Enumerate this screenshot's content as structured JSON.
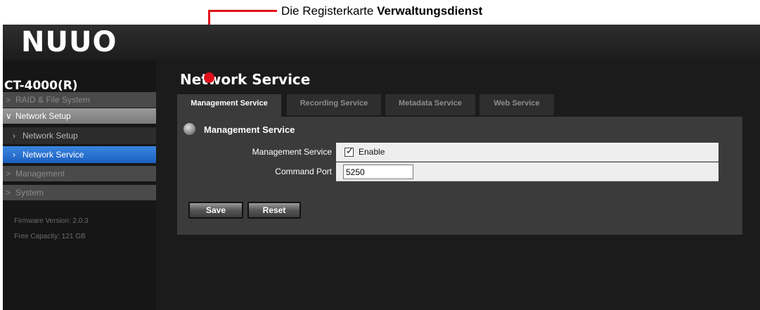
{
  "annotation": {
    "prefix": "Die Registerkarte ",
    "emphasis": "Verwaltungsdienst",
    "color": "#e0101a"
  },
  "header": {
    "logo": "NUUO",
    "trademark": "™"
  },
  "sidebar": {
    "device_name": "CT-4000(R)",
    "items": [
      {
        "label": "RAID & File System",
        "icon": "chevron-right-icon"
      },
      {
        "label": "Network Setup",
        "icon": "chevron-down-icon",
        "expanded": true
      },
      {
        "label": "Network Setup",
        "icon": "chevron-right-icon",
        "sub": true
      },
      {
        "label": "Network Service",
        "icon": "chevron-right-icon",
        "sub": true,
        "selected": true
      },
      {
        "label": "Management",
        "icon": "chevron-right-icon"
      },
      {
        "label": "System",
        "icon": "chevron-right-icon"
      }
    ],
    "firmware": "Firmware Version: 2.0.3",
    "capacity": "Free Capacity: 121 GB",
    "selected_color": "#1c5fbf"
  },
  "main": {
    "title": "Network Service",
    "tabs": [
      {
        "label": "Management Service",
        "active": true
      },
      {
        "label": "Recording Service"
      },
      {
        "label": "Metadata Service"
      },
      {
        "label": "Web Service"
      }
    ],
    "section_title": "Management Service",
    "fields": {
      "service_label": "Management Service",
      "service_checkbox_label": "Enable",
      "service_enabled": true,
      "port_label": "Command Port",
      "port_value": "5250"
    },
    "buttons": {
      "save": "Save",
      "reset": "Reset"
    }
  }
}
